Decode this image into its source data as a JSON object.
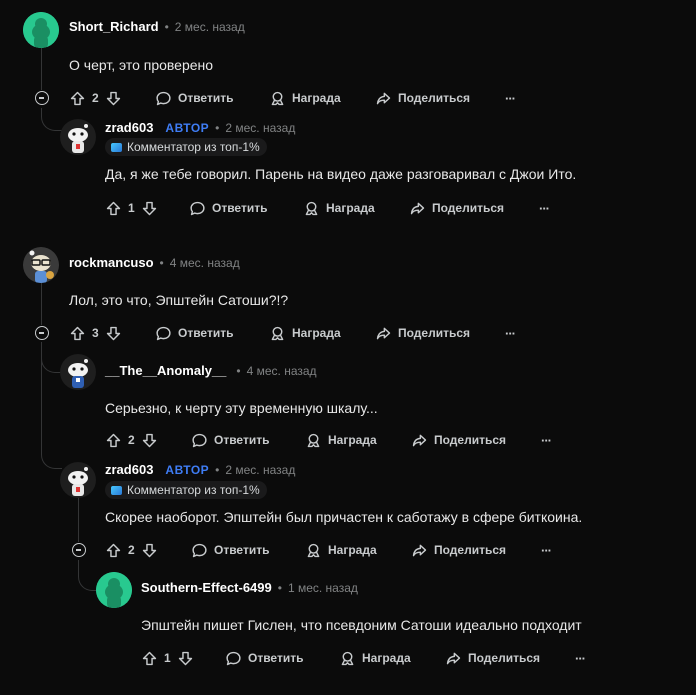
{
  "labels": {
    "reply": "Ответить",
    "award": "Награда",
    "share": "Поделиться",
    "more": "···",
    "author_badge": "АВТОР",
    "flair": "Комментатор из топ-1%",
    "dot": "•"
  },
  "comments": [
    {
      "user": "Short_Richard",
      "time": "2 мес. назад",
      "text": "О черт, это проверено",
      "votes": "2"
    },
    {
      "user": "zrad603",
      "time": "2 мес. назад",
      "text": "Да, я же тебе говорил. Парень на видео даже разговаривал с Джои Ито.",
      "votes": "1"
    },
    {
      "user": "rockmancuso",
      "time": "4 мес. назад",
      "text": "Лол, это что, Эпштейн Сатоши?!?",
      "votes": "3"
    },
    {
      "user": "__The__Anomaly__",
      "time": "4 мес. назад",
      "text": "Серьезно, к черту эту временную шкалу...",
      "votes": "2"
    },
    {
      "user": "zrad603",
      "time": "2 мес. назад",
      "text": "Скорее наоборот. Эпштейн был причастен к саботажу в сфере биткоина.",
      "votes": "2"
    },
    {
      "user": "Southern-Effect-6499",
      "time": "1 мес. назад",
      "text": "Эпштейн пишет Гислен, что псевдоним Сатоши идеально подходит",
      "votes": "1"
    }
  ]
}
